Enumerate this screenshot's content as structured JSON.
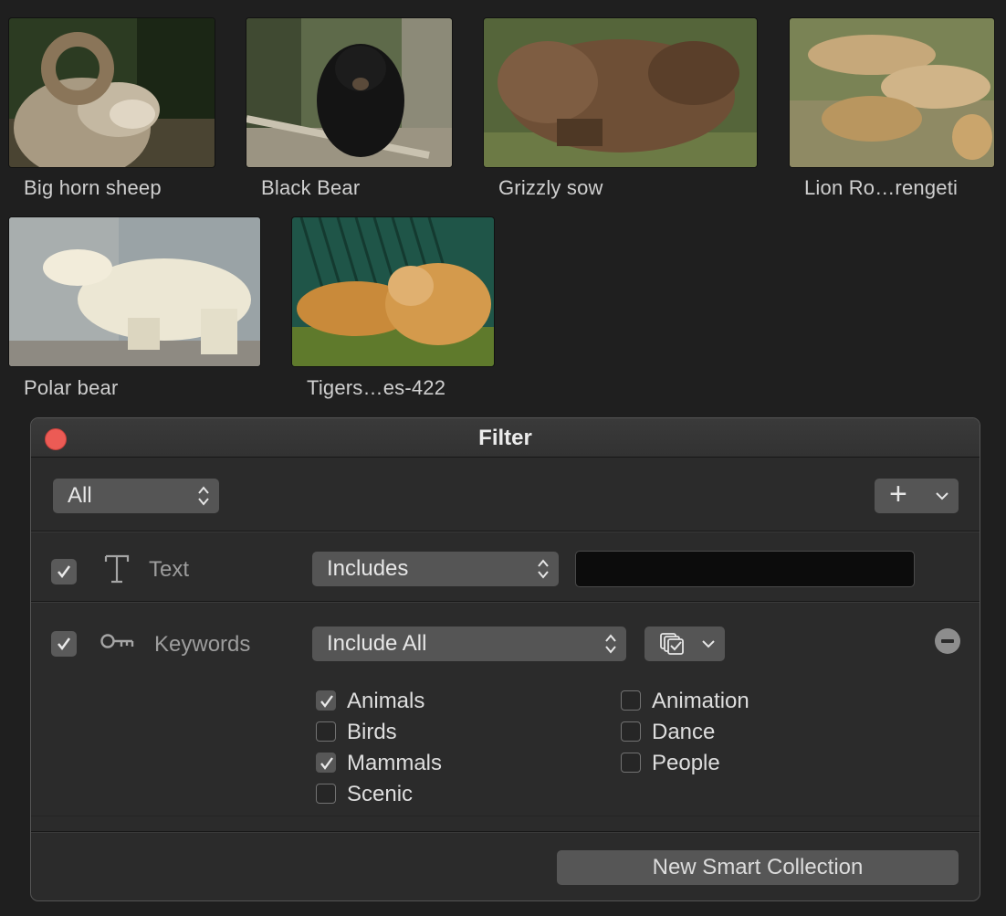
{
  "clips": [
    {
      "name": "Big horn sheep",
      "icon": "sheep-thumbnail"
    },
    {
      "name": "Black Bear",
      "icon": "black-bear-thumbnail"
    },
    {
      "name": "Grizzly sow",
      "icon": "grizzly-thumbnail"
    },
    {
      "name": "Lion Ro…rengeti",
      "icon": "lions-thumbnail"
    },
    {
      "name": "Polar bear",
      "icon": "polar-bear-thumbnail"
    },
    {
      "name": "Tigers…es-422",
      "icon": "tigers-thumbnail"
    }
  ],
  "keyword_bar_color": "#1e8ee8",
  "filter": {
    "title": "Filter",
    "match_popup": "All",
    "add_button": "+",
    "text_rule": {
      "label": "Text",
      "operator": "Includes",
      "value": "",
      "enabled": true
    },
    "keyword_rule": {
      "label": "Keywords",
      "operator": "Include All",
      "enabled": true,
      "keywords": [
        {
          "label": "Animals",
          "checked": true
        },
        {
          "label": "Birds",
          "checked": false
        },
        {
          "label": "Mammals",
          "checked": true
        },
        {
          "label": "Scenic",
          "checked": false
        },
        {
          "label": "Animation",
          "checked": false
        },
        {
          "label": "Dance",
          "checked": false
        },
        {
          "label": "People",
          "checked": false
        }
      ]
    },
    "new_collection_button": "New Smart Collection"
  }
}
